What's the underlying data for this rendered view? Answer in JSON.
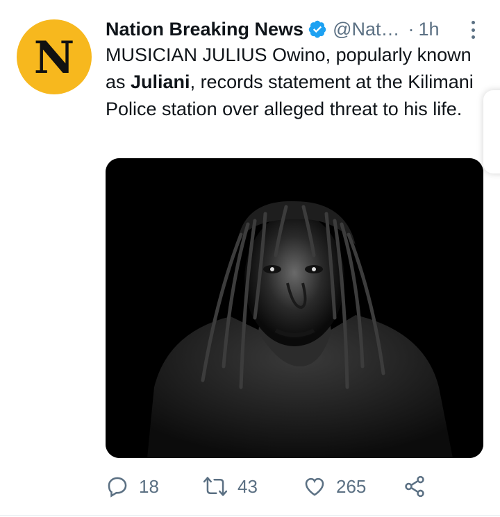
{
  "account": {
    "avatar_letter": "N",
    "avatar_color": "#f7b81e",
    "name": "Nation Breaking News",
    "verified_icon": "verified-badge-icon",
    "handle": "@Nat…",
    "separator": "·",
    "time": "1h"
  },
  "tweet": {
    "text_before": "MUSICIAN JULIUS Owino, popularly known as ",
    "text_bold": "Juliani",
    "text_after": ", records statement at the Kilimani Police station over alleged threat to his life."
  },
  "actions": {
    "reply_count": "18",
    "retweet_count": "43",
    "like_count": "265",
    "icons": [
      "reply-icon",
      "retweet-icon",
      "like-icon",
      "share-icon"
    ]
  },
  "colors": {
    "accent": "#1da1f2",
    "secondary_text": "#5b7083"
  }
}
